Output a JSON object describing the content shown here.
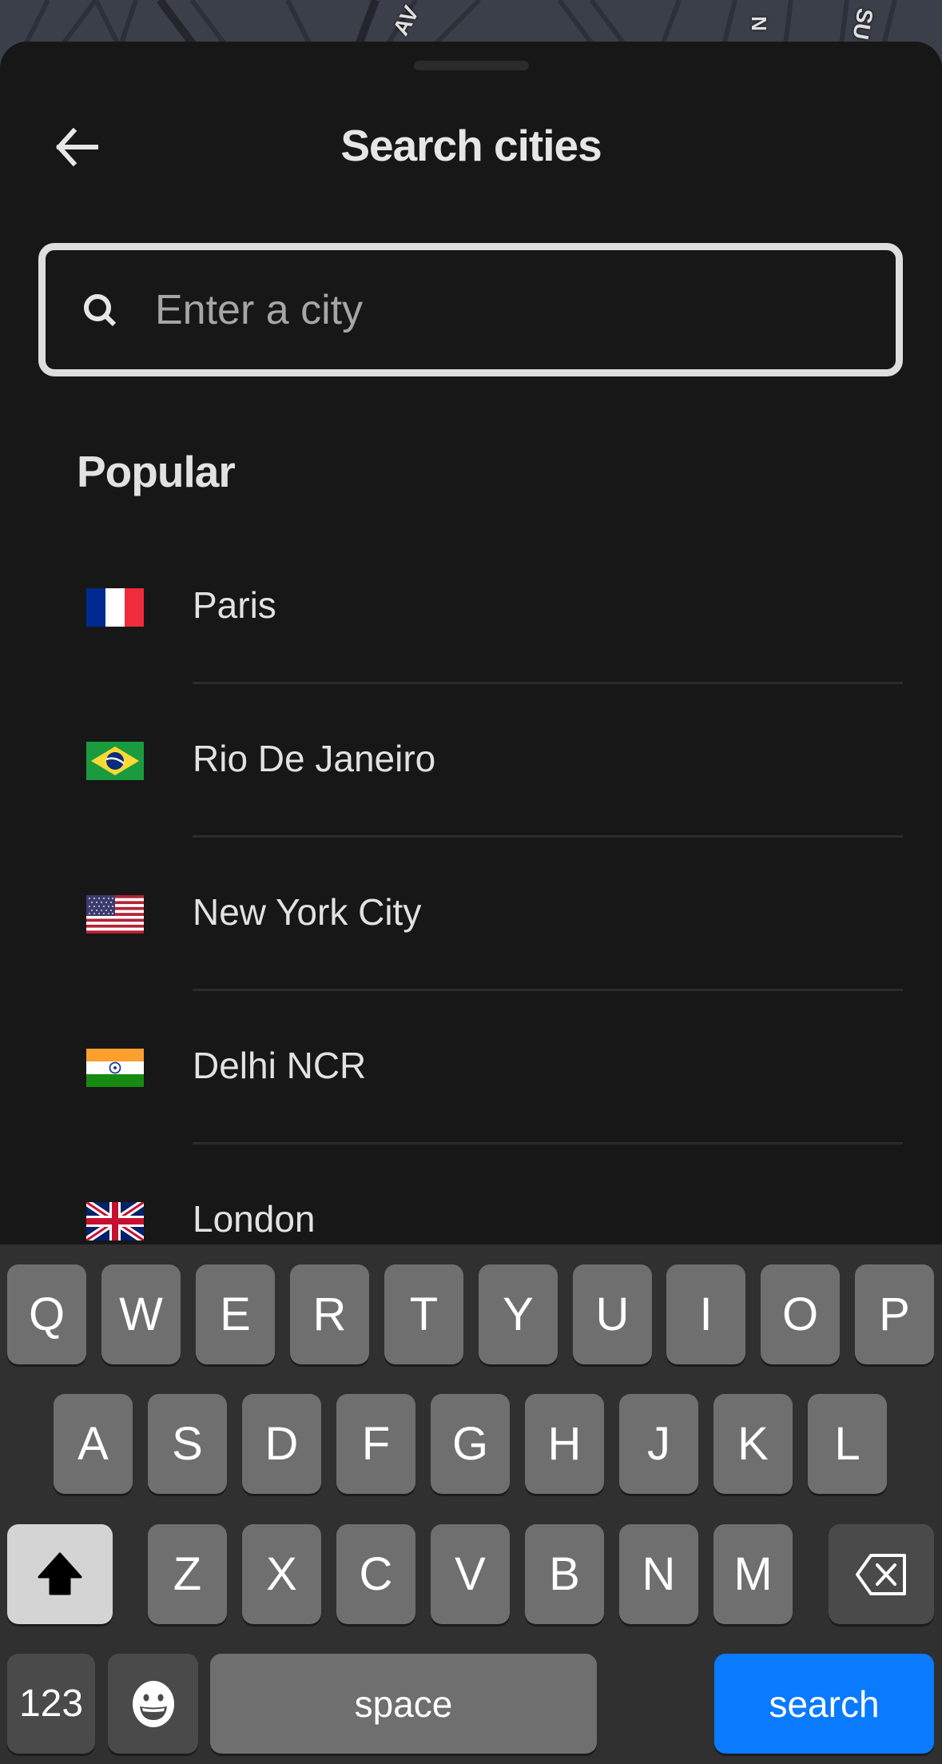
{
  "header": {
    "title": "Search cities",
    "back_icon": "arrow-left-icon"
  },
  "search": {
    "placeholder": "Enter a city",
    "value": "",
    "icon": "search-icon"
  },
  "popular": {
    "title": "Popular",
    "cities": [
      {
        "name": "Paris",
        "flag": "france-flag-icon"
      },
      {
        "name": "Rio De Janeiro",
        "flag": "brazil-flag-icon"
      },
      {
        "name": "New York City",
        "flag": "usa-flag-icon"
      },
      {
        "name": "Delhi NCR",
        "flag": "india-flag-icon"
      },
      {
        "name": "London",
        "flag": "uk-flag-icon"
      }
    ]
  },
  "keyboard": {
    "row1": [
      "Q",
      "W",
      "E",
      "R",
      "T",
      "Y",
      "U",
      "I",
      "O",
      "P"
    ],
    "row2": [
      "A",
      "S",
      "D",
      "F",
      "G",
      "H",
      "J",
      "K",
      "L"
    ],
    "row3": [
      "Z",
      "X",
      "C",
      "V",
      "B",
      "N",
      "M"
    ],
    "shift_icon": "shift-icon",
    "backspace_icon": "backspace-icon",
    "numbers_label": "123",
    "emoji_icon": "emoji-icon",
    "space_label": "space",
    "search_label": "search",
    "accent_color": "#0a7aff"
  },
  "map": {
    "street_labels": [
      "AV",
      "N",
      "SU"
    ]
  }
}
